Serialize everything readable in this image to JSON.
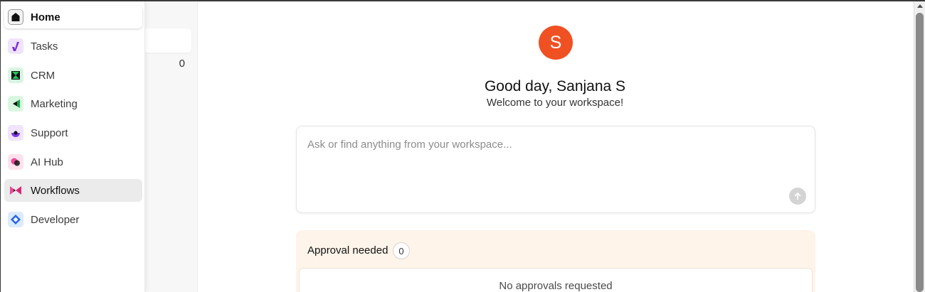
{
  "nav": {
    "items": [
      {
        "label": "Home",
        "icon": "home-icon"
      },
      {
        "label": "Tasks",
        "icon": "tasks-icon"
      },
      {
        "label": "CRM",
        "icon": "crm-icon"
      },
      {
        "label": "Marketing",
        "icon": "marketing-icon"
      },
      {
        "label": "Support",
        "icon": "support-icon"
      },
      {
        "label": "AI Hub",
        "icon": "ai-hub-icon"
      },
      {
        "label": "Workflows",
        "icon": "workflows-icon"
      },
      {
        "label": "Developer",
        "icon": "developer-icon"
      }
    ],
    "active": "Home",
    "hovered": "Workflows"
  },
  "subpanel": {
    "count": "0"
  },
  "main": {
    "avatar_initial": "S",
    "avatar_color": "#ef5123",
    "greeting": "Good day, Sanjana S",
    "welcome": "Welcome to your workspace!",
    "ask_placeholder": "Ask or find anything from your workspace...",
    "approval": {
      "title": "Approval needed",
      "count": "0",
      "empty_text": "No approvals requested"
    }
  }
}
